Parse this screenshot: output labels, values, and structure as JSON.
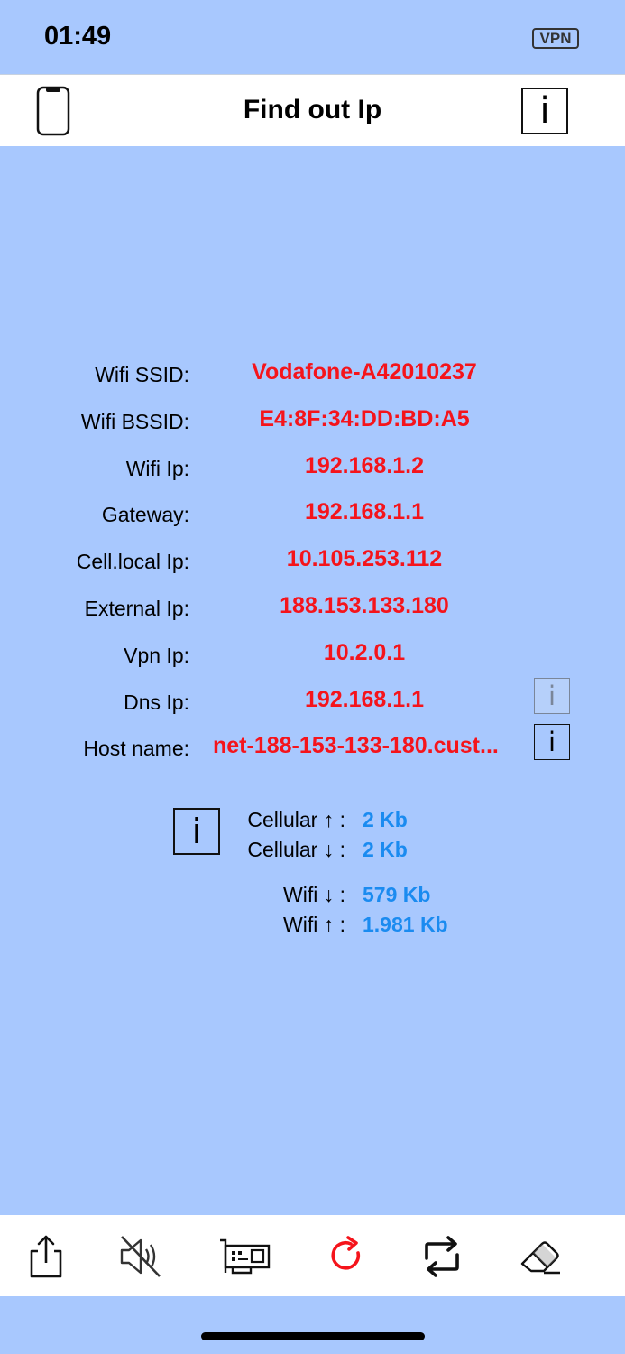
{
  "status_bar": {
    "time": "01:49",
    "vpn_label": "VPN"
  },
  "nav": {
    "title": "Find out Ip",
    "info_glyph": "i",
    "left_icon": "iphone-icon",
    "right_icon": "info-icon"
  },
  "info": {
    "rows": [
      {
        "label": "Wifi SSID:",
        "value": "Vodafone-A42010237"
      },
      {
        "label": "Wifi BSSID:",
        "value": "E4:8F:34:DD:BD:A5"
      },
      {
        "label": "Wifi Ip:",
        "value": "192.168.1.2"
      },
      {
        "label": "Gateway:",
        "value": "192.168.1.1"
      },
      {
        "label": "Cell.local Ip:",
        "value": "10.105.253.112"
      },
      {
        "label": "External Ip:",
        "value": "188.153.133.180"
      },
      {
        "label": "Vpn Ip:",
        "value": "10.2.0.1"
      },
      {
        "label": "Dns Ip:",
        "value": "192.168.1.1"
      },
      {
        "label": "Host name:",
        "value": "net-188-153-133-180.cust..."
      }
    ],
    "info_glyph": "i"
  },
  "traffic": {
    "info_glyph": "i",
    "cellular_up_label": "Cellular ↑ :",
    "cellular_up_value": "2 Kb",
    "cellular_down_label": "Cellular ↓ :",
    "cellular_down_value": "2 Kb",
    "wifi_down_label": "Wifi ↓ :",
    "wifi_down_value": "579 Kb",
    "wifi_up_label": "Wifi ↑ :",
    "wifi_up_value": "1.981 Kb"
  },
  "toolbar": {
    "icons": [
      "share-icon",
      "speaker-muted-icon",
      "network-card-icon",
      "refresh-icon",
      "repeat-icon",
      "eraser-icon"
    ]
  },
  "colors": {
    "background": "#a8c8fe",
    "value_red": "#f5141b",
    "value_blue": "#1a8bf0",
    "bar_white": "#ffffff"
  }
}
